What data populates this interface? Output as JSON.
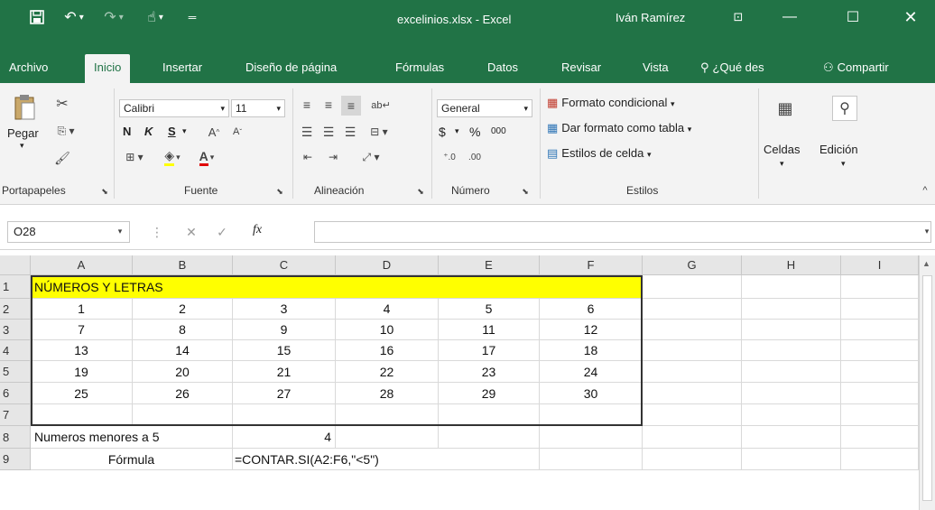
{
  "window": {
    "title": "excelinios.xlsx  -  Excel",
    "user": "Iván Ramírez",
    "save_icon": "save-icon",
    "colors": {
      "excel_green": "#217346",
      "highlight_yellow": "#ffff00"
    }
  },
  "tabs": [
    "Archivo",
    "Inicio",
    "Insertar",
    "Diseño de página",
    "Fórmulas",
    "Datos",
    "Revisar",
    "Vista",
    "¿Qué des",
    "Compartir"
  ],
  "ribbon": {
    "clipboard": {
      "paste": "Pegar",
      "label": "Portapapeles"
    },
    "font": {
      "name": "Calibri",
      "size": "11",
      "bold": "N",
      "italic": "K",
      "underline": "S",
      "label": "Fuente"
    },
    "alignment": {
      "label": "Alineación"
    },
    "number": {
      "format": "General",
      "currency": "$",
      "percent": "%",
      "thousands": "000",
      "label": "Número"
    },
    "styles": {
      "conditional": "Formato condicional",
      "as_table": "Dar formato como tabla",
      "cell_styles": "Estilos de celda",
      "label": "Estilos"
    },
    "cells": {
      "label": "Celdas"
    },
    "editing": {
      "label": "Edición"
    }
  },
  "formula_bar": {
    "name_box": "O28",
    "fx": "fx",
    "value": ""
  },
  "grid": {
    "columns": [
      "A",
      "B",
      "C",
      "D",
      "E",
      "F",
      "G",
      "H",
      "I"
    ],
    "rows": [
      "1",
      "2",
      "3",
      "4",
      "5",
      "6",
      "7",
      "8",
      "9"
    ],
    "title": "NÚMEROS Y LETRAS",
    "values": [
      [
        "1",
        "2",
        "3",
        "4",
        "5",
        "6"
      ],
      [
        "7",
        "8",
        "9",
        "10",
        "11",
        "12"
      ],
      [
        "13",
        "14",
        "15",
        "16",
        "17",
        "18"
      ],
      [
        "19",
        "20",
        "21",
        "22",
        "23",
        "24"
      ],
      [
        "25",
        "26",
        "27",
        "28",
        "29",
        "30"
      ]
    ],
    "row8_label": "Numeros menores a 5",
    "row8_value": "4",
    "row9_label": "Fórmula",
    "row9_formula": "=CONTAR.SI(A2:F6,\"<5\")"
  }
}
